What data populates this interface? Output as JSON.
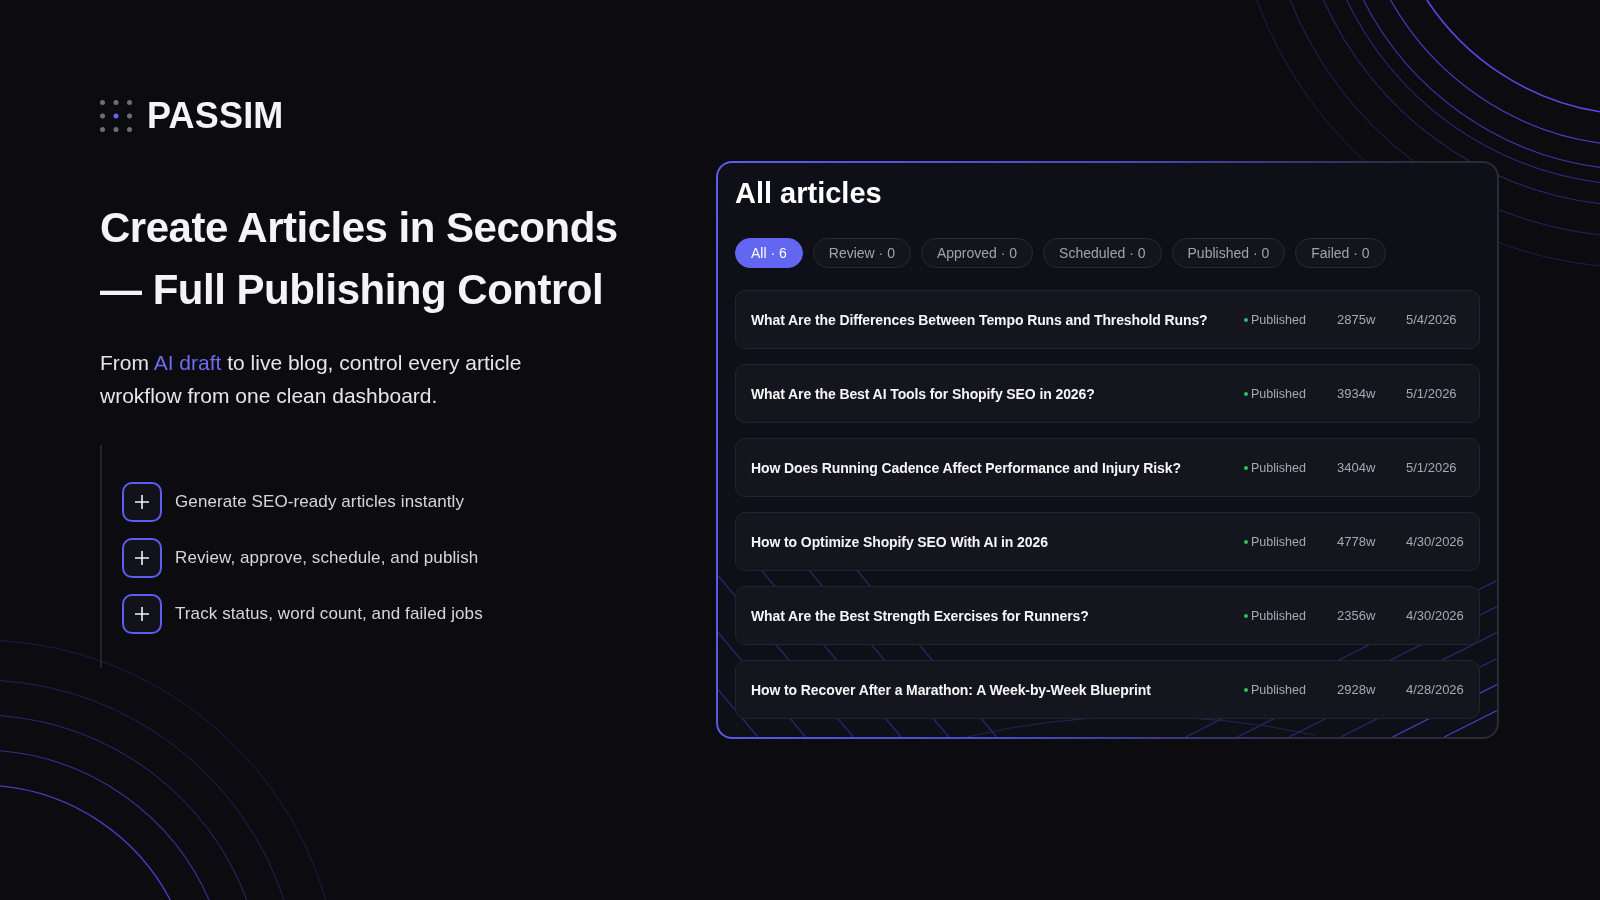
{
  "logo": {
    "name": "PASSIM"
  },
  "hero": {
    "headline": "Create Articles in Seconds — Full Publishing Control",
    "subtitle": {
      "before": "From",
      "highlight": "AI draft",
      "after": "to live blog, control every article wrokflow from one clean dashboard."
    }
  },
  "features": [
    {
      "label": "Generate SEO-ready articles instantly"
    },
    {
      "label": "Review, approve, schedule, and publish"
    },
    {
      "label": "Track status, word count, and failed jobs"
    }
  ],
  "panel": {
    "title": "All articles",
    "filters": [
      {
        "label": "All · 6",
        "selected": true
      },
      {
        "label": "Review · 0",
        "selected": false
      },
      {
        "label": "Approved · 0",
        "selected": false
      },
      {
        "label": "Scheduled · 0",
        "selected": false
      },
      {
        "label": "Published · 0",
        "selected": false
      },
      {
        "label": "Failed · 0",
        "selected": false
      }
    ],
    "articles": [
      {
        "title": "What Are the Differences Between Tempo Runs and Threshold Runs?",
        "status": "Published",
        "color": "#22c55e",
        "words": "2875w",
        "date": "5/4/2026"
      },
      {
        "title": "What Are the Best AI Tools for Shopify SEO in 2026?",
        "status": "Published",
        "color": "#22c55e",
        "words": "3934w",
        "date": "5/1/2026"
      },
      {
        "title": "How Does Running Cadence Affect Performance and Injury Risk?",
        "status": "Published",
        "color": "#22c55e",
        "words": "3404w",
        "date": "5/1/2026"
      },
      {
        "title": "How to Optimize Shopify SEO With AI in 2026",
        "status": "Published",
        "color": "#22c55e",
        "words": "4778w",
        "date": "4/30/2026"
      },
      {
        "title": "What Are the Best Strength Exercises for Runners?",
        "status": "Published",
        "color": "#22c55e",
        "words": "2356w",
        "date": "4/30/2026"
      },
      {
        "title": "How to Recover After a Marathon: A Week-by-Week Blueprint",
        "status": "Published",
        "color": "#22c55e",
        "words": "2928w",
        "date": "4/28/2026"
      }
    ]
  }
}
